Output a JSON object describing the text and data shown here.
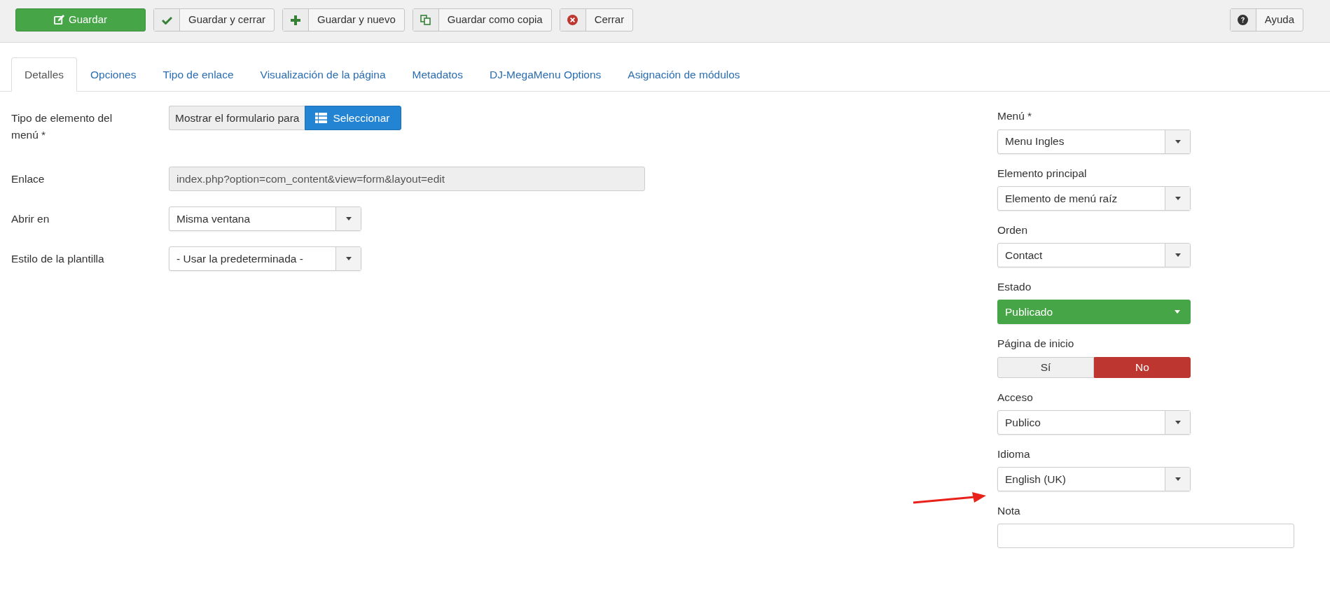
{
  "toolbar": {
    "buttons": [
      {
        "label": "Guardar",
        "kind": "edit"
      },
      {
        "label": "Guardar y cerrar",
        "kind": "check"
      },
      {
        "label": "Guardar y nuevo",
        "kind": "plus"
      },
      {
        "label": "Guardar como copia",
        "kind": "copy"
      },
      {
        "label": "Cerrar",
        "kind": "close"
      }
    ],
    "help_button": {
      "label": "Ayuda",
      "kind": "help"
    }
  },
  "tabs": [
    {
      "label": "Detalles",
      "selected": true
    },
    {
      "label": "Opciones",
      "selected": false
    },
    {
      "label": "Tipo de enlace",
      "selected": false
    },
    {
      "label": "Visualización de la página",
      "selected": false
    },
    {
      "label": "Metadatos",
      "selected": false
    },
    {
      "label": "DJ-MegaMenu Options",
      "selected": false
    },
    {
      "label": "Asignación de módulos",
      "selected": false
    }
  ],
  "main_fields": [
    {
      "label": "Tipo de elemento del menú *",
      "kind": "chooser",
      "value": "Mostrar el formulario para",
      "button": "Seleccionar"
    },
    {
      "label": "Enlace",
      "kind": "readonly",
      "value": "index.php?option=com_content&view=form&layout=edit"
    },
    {
      "label": "Abrir en",
      "kind": "select",
      "value": "Misma ventana"
    },
    {
      "label": "Estilo de la plantilla",
      "kind": "select",
      "value": "- Usar la predeterminada -"
    }
  ],
  "side_fields": [
    {
      "label": "Menú *",
      "kind": "select",
      "value": "Menu Ingles"
    },
    {
      "label": "Elemento principal",
      "kind": "select",
      "value": "Elemento de menú raíz"
    },
    {
      "label": "Orden",
      "kind": "select",
      "value": "Contact"
    },
    {
      "label": "Estado",
      "kind": "status",
      "value": "Publicado"
    },
    {
      "label": "Página de inicio",
      "kind": "toggle",
      "options": [
        {
          "label": "Sí",
          "selected": false
        },
        {
          "label": "No",
          "selected": true
        }
      ]
    },
    {
      "label": "Acceso",
      "kind": "select",
      "value": "Publico"
    },
    {
      "label": "Idioma",
      "kind": "select",
      "value": "English (UK)"
    },
    {
      "label": "Nota",
      "kind": "text"
    }
  ]
}
